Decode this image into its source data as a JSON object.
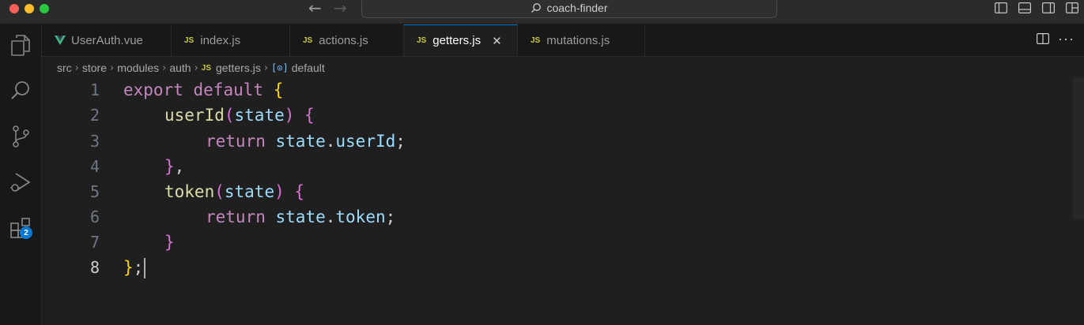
{
  "window": {
    "search_text": "coach-finder"
  },
  "activity_bar": {
    "items": [
      {
        "name": "explorer",
        "icon": "files-icon"
      },
      {
        "name": "search",
        "icon": "search-icon"
      },
      {
        "name": "source-control",
        "icon": "source-control-icon"
      },
      {
        "name": "run-debug",
        "icon": "run-debug-icon"
      },
      {
        "name": "extensions",
        "icon": "extensions-icon",
        "badge": "2"
      }
    ]
  },
  "tabs": [
    {
      "label": "UserAuth.vue",
      "icon": "vue-icon",
      "active": false
    },
    {
      "label": "index.js",
      "icon_text": "JS",
      "active": false
    },
    {
      "label": "actions.js",
      "icon_text": "JS",
      "active": false
    },
    {
      "label": "getters.js",
      "icon_text": "JS",
      "active": true,
      "close": "✕"
    },
    {
      "label": "mutations.js",
      "icon_text": "JS",
      "active": false
    }
  ],
  "breadcrumb": {
    "parts": [
      "src",
      "store",
      "modules",
      "auth"
    ],
    "file_icon": "JS",
    "file": "getters.js",
    "symbol": "default"
  },
  "editor": {
    "line_numbers": [
      "1",
      "2",
      "3",
      "4",
      "5",
      "6",
      "7",
      "8"
    ],
    "code_tokens": {
      "l1": [
        "export",
        "default",
        "{"
      ],
      "l2": [
        "userId",
        "(",
        "state",
        ")",
        "{"
      ],
      "l3": [
        "return",
        "state",
        ".",
        "userId",
        ";"
      ],
      "l4": [
        "}",
        ","
      ],
      "l5": [
        "token",
        "(",
        "state",
        ")",
        "{"
      ],
      "l6": [
        "return",
        "state",
        ".",
        "token",
        ";"
      ],
      "l7": [
        "}"
      ],
      "l8": [
        "}",
        ";"
      ]
    },
    "current_line": "8"
  },
  "colors": {
    "keyword": "#c586c0",
    "function": "#dcdcaa",
    "variable": "#9cdcfe",
    "bracket_level1": "#ffd700",
    "bracket_level2": "#da70d6",
    "accent": "#0078d4",
    "js_icon": "#cbcb41",
    "vue_icon": "#41b883"
  }
}
